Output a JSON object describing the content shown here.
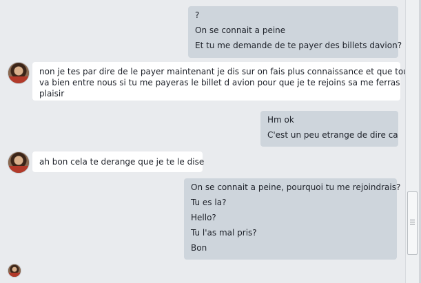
{
  "messages": {
    "out1": [
      "?",
      "On se connait a peine",
      "Et tu me demande de te payer des billets davion?"
    ],
    "in1": [
      "non je tes par dire de le payer maintenant je dis sur on fais plus connaissance et que tout",
      "va bien entre nous si tu me payeras le billet d avion pour que je te rejoins sa me ferras",
      "plaisir"
    ],
    "out2": [
      "Hm ok",
      "C'est un peu etrange de dire ca"
    ],
    "in2": [
      "ah bon cela te derange que je te le dise"
    ],
    "out3": [
      "On se connait a peine, pourquoi tu me rejoindrais?",
      "Tu es la?",
      "Hello?",
      "Tu l'as mal pris?",
      "Bon"
    ]
  }
}
